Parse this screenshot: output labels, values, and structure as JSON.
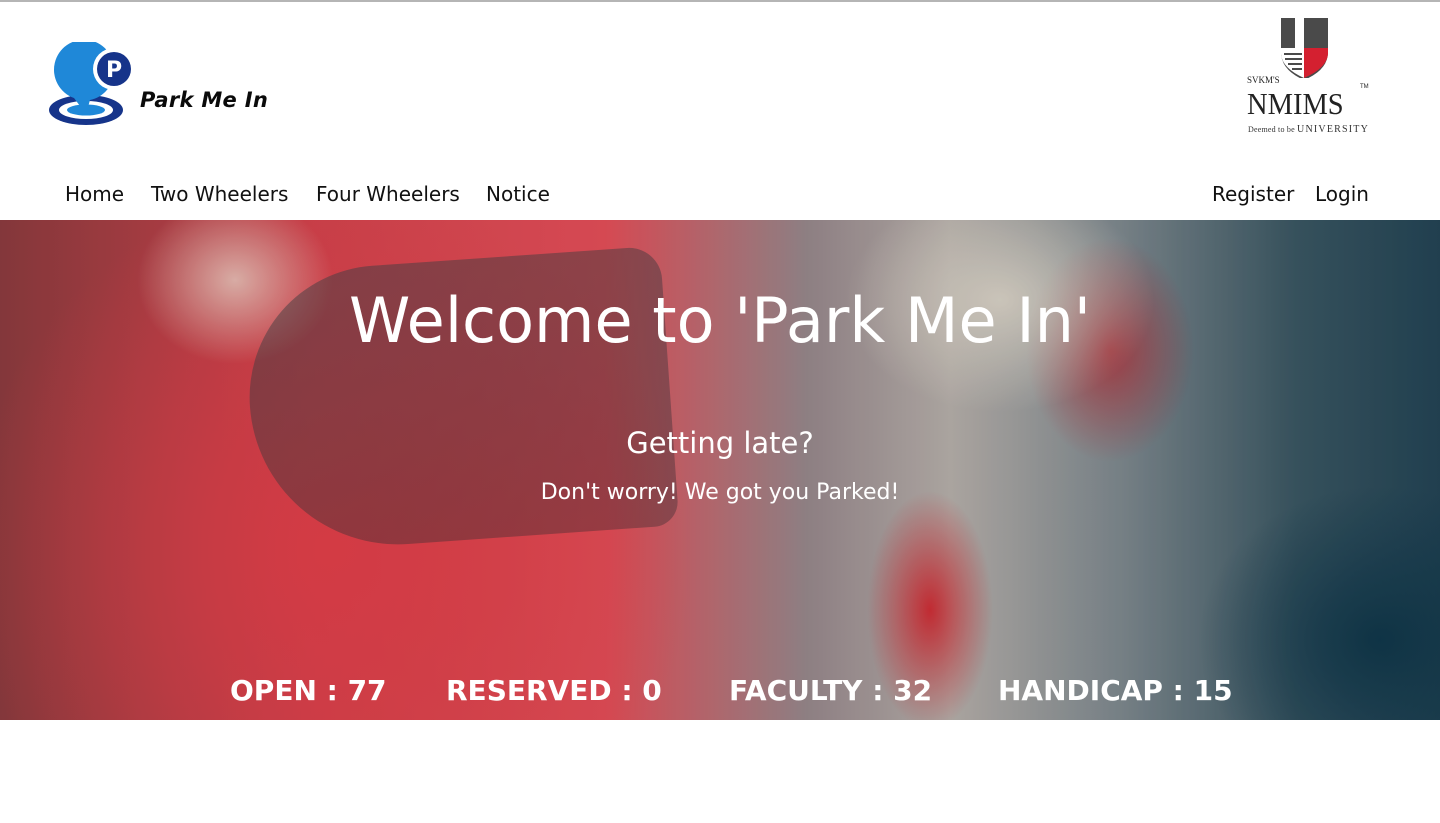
{
  "brand": {
    "logo_text": "Park Me In",
    "logo_letter": "P",
    "logo_icon": "parking-pin-icon",
    "accent_color": "#1f88d8",
    "dark_blue": "#16348a"
  },
  "partner": {
    "prefix": "SVKM'S",
    "name": "NMIMS",
    "tm": "TM",
    "tagline_small": "Deemed to be",
    "tagline_big": "UNIVERSITY",
    "crest_icon": "university-crest-icon"
  },
  "nav": {
    "left": [
      "Home",
      "Two Wheelers",
      "Four Wheelers",
      "Notice"
    ],
    "right": [
      "Register",
      "Login"
    ]
  },
  "hero": {
    "title": "Welcome to 'Park Me In'",
    "subtitle": "Getting late?",
    "tagline": "Don't worry! We got you Parked!"
  },
  "stats": [
    {
      "label": "OPEN",
      "value": "77",
      "text": "OPEN : 77"
    },
    {
      "label": "RESERVED",
      "value": "0",
      "text": "RESERVED : 0"
    },
    {
      "label": "FACULTY",
      "value": "32",
      "text": "FACULTY : 32"
    },
    {
      "label": "HANDICAP",
      "value": "15",
      "text": "HANDICAP : 15"
    }
  ]
}
